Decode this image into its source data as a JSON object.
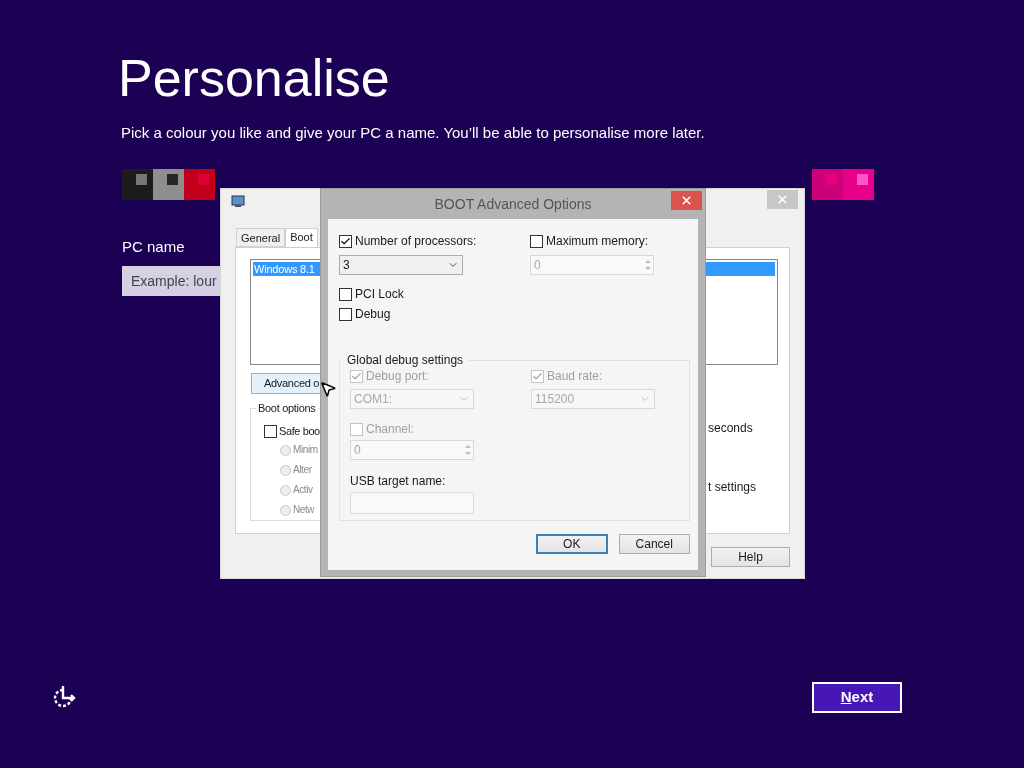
{
  "page": {
    "title": "Personalise",
    "subtitle": "Pick a colour you like and give your PC a name. You’ll be able to personalise more later.",
    "pc_name_label": "PC name",
    "pc_name_placeholder": "Example: lour",
    "next_button": "Next"
  },
  "swatches_left": [
    {
      "color": "#1c1c1c",
      "accent": {
        "color": "#767676"
      }
    },
    {
      "color": "#8e8e8e",
      "accent": {
        "color": "#262626"
      }
    },
    {
      "color": "#c0001a",
      "accent": {
        "color": "#de0030"
      }
    }
  ],
  "swatches_right": [
    {
      "color": "#cc0078",
      "accent": {
        "color": "#e6007e"
      }
    },
    {
      "color": "#e6008a",
      "accent": {
        "color": "#ff55c6"
      }
    }
  ],
  "system_configuration": {
    "tabs": [
      {
        "label": "General",
        "selected": false
      },
      {
        "label": "Boot",
        "selected": true
      }
    ],
    "boot_entries": [
      {
        "label": "Windows 8.1",
        "selected": true
      }
    ],
    "advanced_button": "Advanced o",
    "boot_options_label": "Boot options",
    "safe_boot": {
      "label": "Safe boo",
      "checked": false
    },
    "safe_boot_modes": [
      {
        "label": "Minim",
        "selected": false
      },
      {
        "label": "Alter",
        "selected": false
      },
      {
        "label": "Activ",
        "selected": false
      },
      {
        "label": "Netw",
        "selected": false
      }
    ],
    "timeout_unit": "seconds",
    "permanent_label": "t settings",
    "help_button": "Help"
  },
  "advanced_dialog": {
    "title": "BOOT Advanced Options",
    "processors": {
      "label": "Number of processors:",
      "checked": true,
      "value": "3"
    },
    "max_memory": {
      "label": "Maximum memory:",
      "checked": false,
      "value": "0"
    },
    "options": [
      {
        "label": "PCI Lock",
        "checked": false
      },
      {
        "label": "Debug",
        "checked": false
      }
    ],
    "debug_group_title": "Global debug settings",
    "debug_port": {
      "label": "Debug port:",
      "checked": true,
      "disabled": true,
      "value": "COM1:"
    },
    "baud_rate": {
      "label": "Baud rate:",
      "checked": true,
      "disabled": true,
      "value": "115200"
    },
    "channel": {
      "label": "Channel:",
      "checked": false,
      "disabled": true,
      "value": "0"
    },
    "usb_target_label": "USB target name:",
    "buttons": [
      {
        "label": "OK",
        "focused": true
      },
      {
        "label": "Cancel",
        "focused": false
      }
    ]
  }
}
